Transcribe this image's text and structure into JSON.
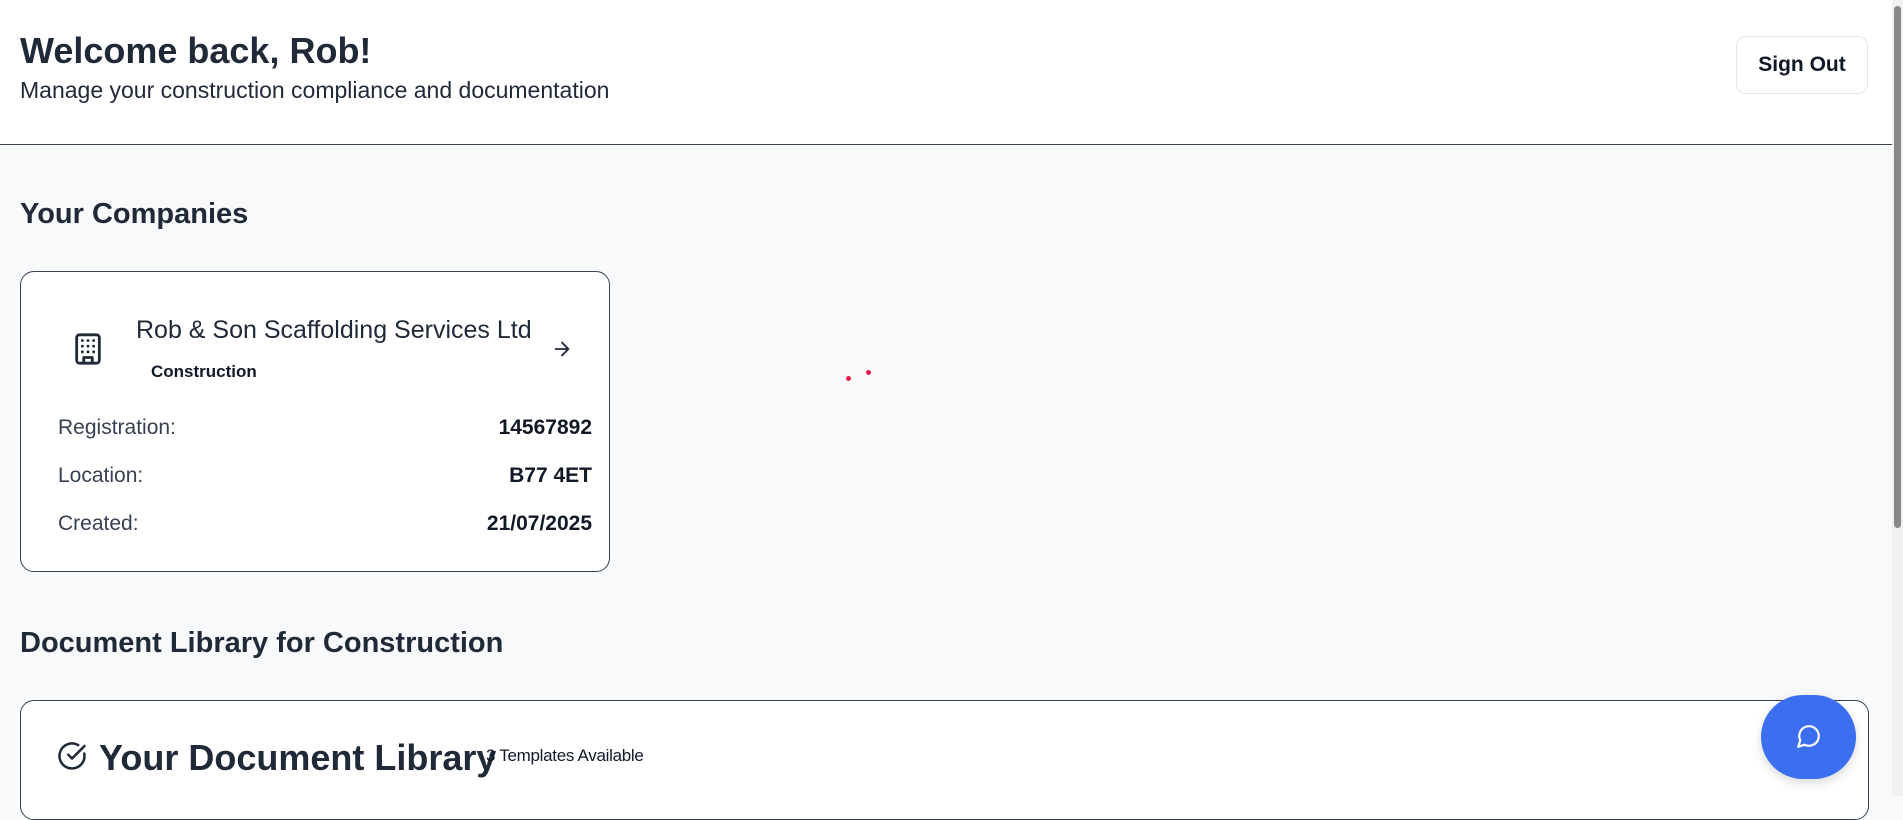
{
  "header": {
    "welcome": "Welcome back, Rob!",
    "subtitle": "Manage your construction compliance and documentation",
    "sign_out_label": "Sign Out"
  },
  "companies": {
    "section_title": "Your Companies",
    "items": [
      {
        "name": "Rob & Son Scaffolding Services Ltd",
        "type": "Construction",
        "registration_label": "Registration:",
        "registration": "14567892",
        "location_label": "Location:",
        "location": "B77 4ET",
        "created_label": "Created:",
        "created": "21/07/2025"
      }
    ]
  },
  "library": {
    "section_title": "Document Library for Construction",
    "card_title": "Your Document Library",
    "templates_badge": "3 Templates Available"
  },
  "icons": {
    "building": "building-icon",
    "arrow": "arrow-right-icon",
    "check": "check-circle-icon",
    "chat": "chat-bubble-icon"
  },
  "colors": {
    "accent": "#3b6ff0",
    "background": "#f8f9fb",
    "card_border": "#374151"
  }
}
